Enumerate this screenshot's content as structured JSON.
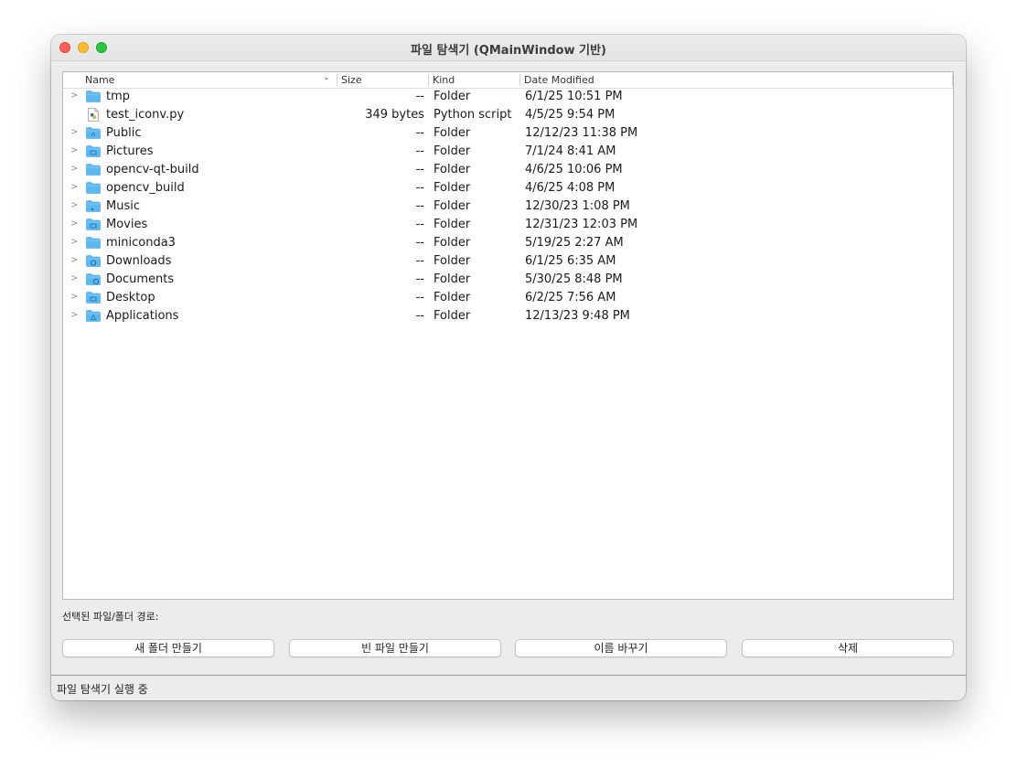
{
  "window": {
    "title": "파일 탐색기 (QMainWindow 기반)"
  },
  "table": {
    "columns": [
      "Name",
      "Size",
      "Kind",
      "Date Modified"
    ],
    "sort_icon": "chevron-down-icon",
    "rows": [
      {
        "name": "tmp",
        "size": "--",
        "kind": "Folder",
        "date": "6/1/25 10:51 PM",
        "icon": "folder-icon",
        "expandable": true
      },
      {
        "name": "test_iconv.py",
        "size": "349 bytes",
        "kind": "Python script",
        "date": "4/5/25 9:54 PM",
        "icon": "python-file-icon",
        "expandable": false
      },
      {
        "name": "Public",
        "size": "--",
        "kind": "Folder",
        "date": "12/12/23 11:38 PM",
        "icon": "public-folder-icon",
        "expandable": true
      },
      {
        "name": "Pictures",
        "size": "--",
        "kind": "Folder",
        "date": "7/1/24 8:41 AM",
        "icon": "pictures-folder-icon",
        "expandable": true
      },
      {
        "name": "opencv-qt-build",
        "size": "--",
        "kind": "Folder",
        "date": "4/6/25 10:06 PM",
        "icon": "folder-icon",
        "expandable": true
      },
      {
        "name": "opencv_build",
        "size": "--",
        "kind": "Folder",
        "date": "4/6/25 4:08 PM",
        "icon": "folder-icon",
        "expandable": true
      },
      {
        "name": "Music",
        "size": "--",
        "kind": "Folder",
        "date": "12/30/23 1:08 PM",
        "icon": "music-folder-icon",
        "expandable": true
      },
      {
        "name": "Movies",
        "size": "--",
        "kind": "Folder",
        "date": "12/31/23 12:03 PM",
        "icon": "movies-folder-icon",
        "expandable": true
      },
      {
        "name": "miniconda3",
        "size": "--",
        "kind": "Folder",
        "date": "5/19/25 2:27 AM",
        "icon": "folder-icon",
        "expandable": true
      },
      {
        "name": "Downloads",
        "size": "--",
        "kind": "Folder",
        "date": "6/1/25 6:35 AM",
        "icon": "downloads-folder-icon",
        "expandable": true
      },
      {
        "name": "Documents",
        "size": "--",
        "kind": "Folder",
        "date": "5/30/25 8:48 PM",
        "icon": "documents-folder-icon",
        "expandable": true
      },
      {
        "name": "Desktop",
        "size": "--",
        "kind": "Folder",
        "date": "6/2/25 7:56 AM",
        "icon": "desktop-folder-icon",
        "expandable": true
      },
      {
        "name": "Applications",
        "size": "--",
        "kind": "Folder",
        "date": "12/13/23 9:48 PM",
        "icon": "applications-folder-icon",
        "expandable": true
      }
    ]
  },
  "path_label": "선택된 파일/폴더 경로:",
  "buttons": {
    "new_folder": "새 폴더 만들기",
    "new_file": "빈 파일 만들기",
    "rename": "이름 바꾸기",
    "delete": "삭제"
  },
  "status": "파일 탐색기 실행 중",
  "colors": {
    "folder": "#5cb8f0",
    "close": "#ff5f57",
    "minimize": "#febc2e",
    "maximize": "#28c840"
  }
}
